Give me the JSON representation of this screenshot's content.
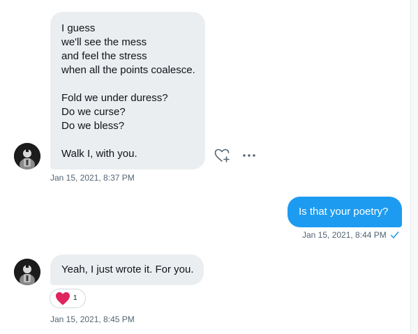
{
  "conversation": {
    "messages": [
      {
        "direction": "received",
        "lines": [
          "I guess",
          "we'll see the mess",
          "and feel the stress",
          "when all the points coalesce.",
          "",
          "Fold we under duress?",
          "Do we curse?",
          "Do we bless?",
          "",
          "Walk I, with you."
        ],
        "timestamp": "Jan 15, 2021, 8:37 PM"
      },
      {
        "direction": "sent",
        "text": "Is that your poetry?",
        "timestamp": "Jan 15, 2021, 8:44 PM",
        "read_icon": "checkmark-icon"
      },
      {
        "direction": "received",
        "text": "Yeah, I just wrote it. For you.",
        "timestamp": "Jan 15, 2021, 8:45 PM",
        "reaction": {
          "icon": "heart-icon",
          "count": "1"
        }
      }
    ]
  },
  "icons": {
    "react": "heart-plus-icon",
    "more": "more-icon"
  },
  "colors": {
    "sent_bubble": "#1d9bf0",
    "received_bubble": "#ebeef0",
    "timestamp": "#536471",
    "reaction_heart": "#e0245e"
  }
}
